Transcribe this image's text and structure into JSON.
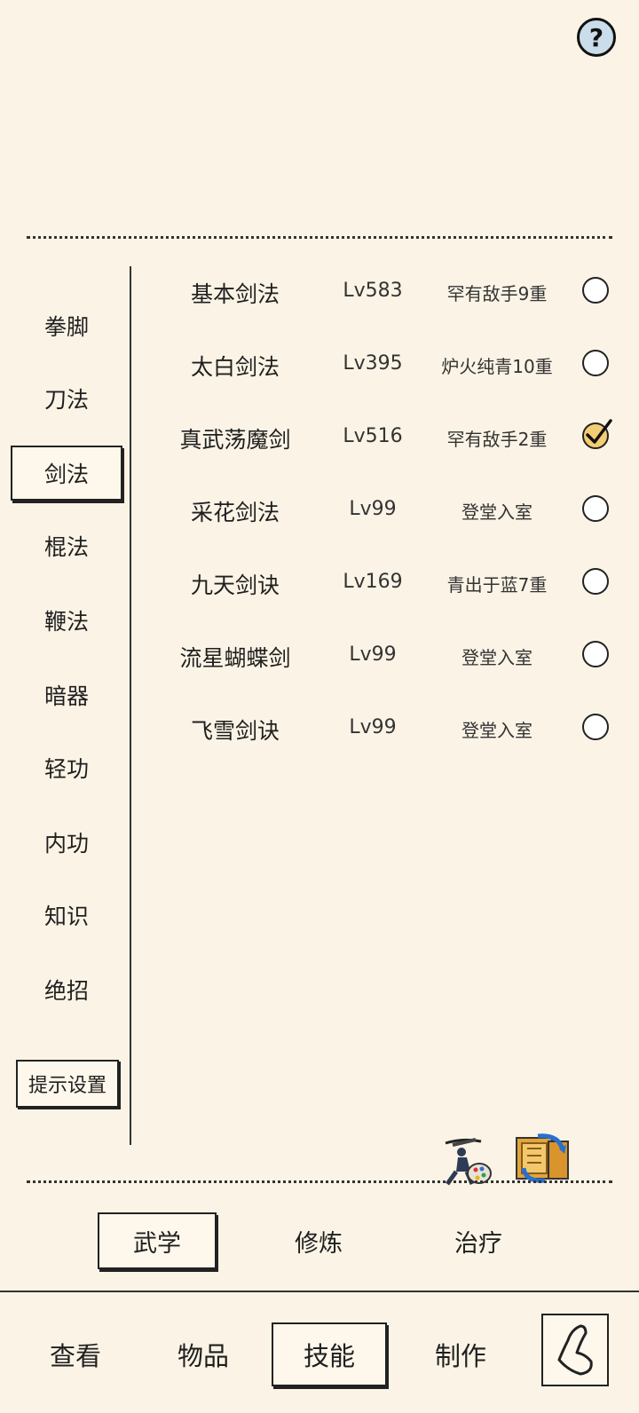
{
  "help": {
    "label": "?"
  },
  "categories": [
    {
      "label": "拳脚",
      "active": false
    },
    {
      "label": "刀法",
      "active": false
    },
    {
      "label": "剑法",
      "active": true
    },
    {
      "label": "棍法",
      "active": false
    },
    {
      "label": "鞭法",
      "active": false
    },
    {
      "label": "暗器",
      "active": false
    },
    {
      "label": "轻功",
      "active": false
    },
    {
      "label": "内功",
      "active": false
    },
    {
      "label": "知识",
      "active": false
    },
    {
      "label": "绝招",
      "active": false
    }
  ],
  "hint_settings": "提示设置",
  "skills": [
    {
      "name": "基本剑法",
      "level": "Lv583",
      "rank": "罕有敌手9重",
      "checked": false
    },
    {
      "name": "太白剑法",
      "level": "Lv395",
      "rank": "炉火纯青10重",
      "checked": false
    },
    {
      "name": "真武荡魔剑",
      "level": "Lv516",
      "rank": "罕有敌手2重",
      "checked": true
    },
    {
      "name": "采花剑法",
      "level": "Lv99",
      "rank": "登堂入室",
      "checked": false
    },
    {
      "name": "九天剑诀",
      "level": "Lv169",
      "rank": "青出于蓝7重",
      "checked": false
    },
    {
      "name": "流星蝴蝶剑",
      "level": "Lv99",
      "rank": "登堂入室",
      "checked": false
    },
    {
      "name": "飞雪剑诀",
      "level": "Lv99",
      "rank": "登堂入室",
      "checked": false
    }
  ],
  "action_icons": [
    "martial-artist-palette-icon",
    "scroll-swap-icon"
  ],
  "sub_tabs": [
    {
      "label": "武学",
      "active": true
    },
    {
      "label": "修炼",
      "active": false
    },
    {
      "label": "治疗",
      "active": false
    }
  ],
  "bottom_nav": [
    {
      "label": "查看",
      "active": false
    },
    {
      "label": "物品",
      "active": false
    },
    {
      "label": "技能",
      "active": true
    },
    {
      "label": "制作",
      "active": false
    }
  ],
  "back_icon": "back-arrow-icon",
  "colors": {
    "background": "#fbf4e6",
    "checked_fill": "#f3cd74",
    "help_fill": "#c9ddea"
  }
}
